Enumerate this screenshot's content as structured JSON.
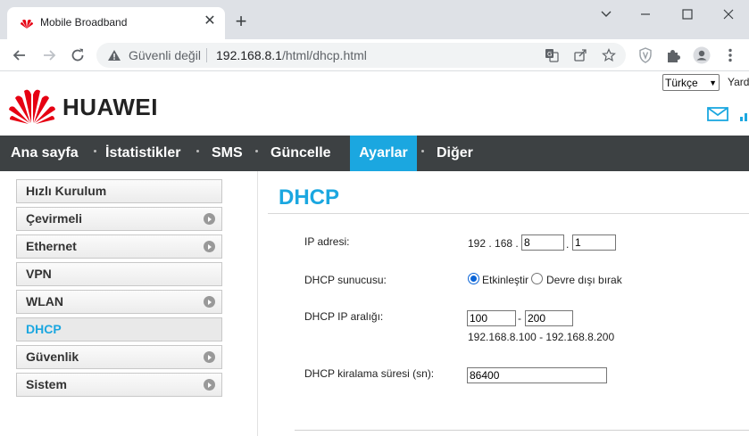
{
  "browser": {
    "tab_title": "Mobile Broadband",
    "security_label": "Güvenli değil",
    "url_host": "192.168.8.1",
    "url_path": "/html/dhcp.html",
    "icons": [
      "huawei-favicon",
      "close-icon",
      "plus-icon",
      "minimize-icon",
      "maximize-icon",
      "window-close-icon",
      "chevron-down-icon",
      "back-icon",
      "forward-icon",
      "reload-icon",
      "warning-icon",
      "translate-icon",
      "share-icon",
      "star-icon",
      "shield-extension-icon",
      "puzzle-icon",
      "profile-icon",
      "more-icon"
    ]
  },
  "header": {
    "brand": "HUAWEI",
    "language_selected": "Türkçe",
    "help_link": "Yard",
    "brand_color": "#e60012"
  },
  "nav": {
    "items": [
      {
        "label": "Ana sayfa"
      },
      {
        "label": "İstatistikler"
      },
      {
        "label": "SMS"
      },
      {
        "label": "Güncelle"
      },
      {
        "label": "Ayarlar",
        "active": true
      },
      {
        "label": "Diğer"
      }
    ],
    "active_color": "#1ba7e0",
    "background": "#3d4143"
  },
  "sidebar": {
    "items": [
      {
        "label": "Hızlı Kurulum",
        "has_submenu": false
      },
      {
        "label": "Çevirmeli",
        "has_submenu": true
      },
      {
        "label": "Ethernet",
        "has_submenu": true
      },
      {
        "label": "VPN",
        "has_submenu": false
      },
      {
        "label": "WLAN",
        "has_submenu": true
      },
      {
        "label": "DHCP",
        "has_submenu": false,
        "active": true
      },
      {
        "label": "Güvenlik",
        "has_submenu": true
      },
      {
        "label": "Sistem",
        "has_submenu": true
      }
    ]
  },
  "main": {
    "title": "DHCP",
    "ip_label": "IP adresi:",
    "ip_prefix": "192 . 168 .",
    "ip_octet3": "8",
    "ip_octet4": "1",
    "ip_dot": ".",
    "server_label": "DHCP sunucusu:",
    "server_enable": "Etkinleştir",
    "server_disable": "Devre dışı bırak",
    "server_enabled": true,
    "range_label": "DHCP IP aralığı:",
    "range_start": "100",
    "range_dash": "-",
    "range_end": "200",
    "range_note": "192.168.8.100 - 192.168.8.200",
    "lease_label": "DHCP kiralama süresi (sn):",
    "lease_value": "86400"
  }
}
